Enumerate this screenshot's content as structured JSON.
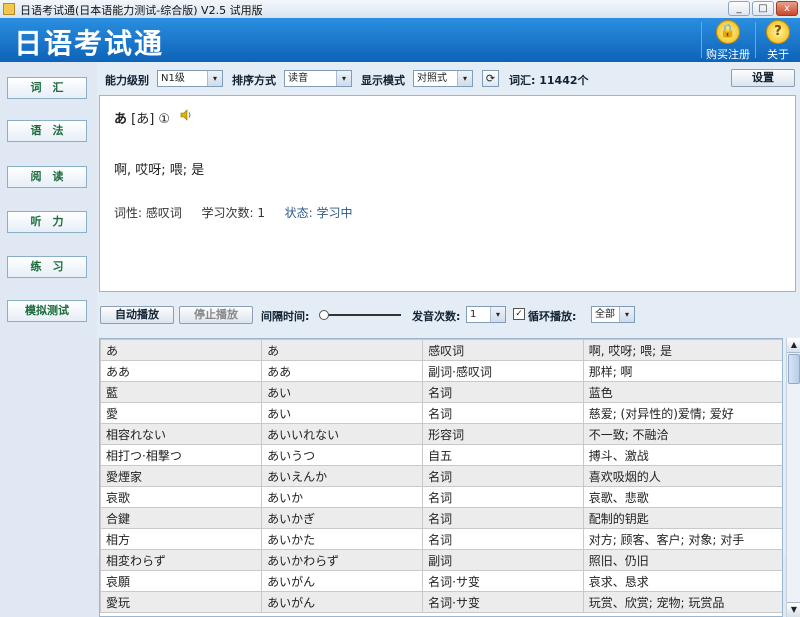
{
  "window": {
    "title": "日语考试通(日本语能力测试-综合版) V2.5 试用版",
    "min": "_",
    "max": "□",
    "close": "x"
  },
  "banner": {
    "app_title": "日语考试通",
    "buy_label": "购买注册",
    "about_label": "关于",
    "help_glyph": "?"
  },
  "nav": {
    "items": [
      "词　汇",
      "语　法",
      "阅　读",
      "听　力",
      "练　习",
      "模拟测试"
    ]
  },
  "toolbar": {
    "level_label": "能力级别",
    "level_value": "N1级",
    "sort_label": "排序方式",
    "sort_value": "读音",
    "mode_label": "显示模式",
    "mode_value": "对照式",
    "vocab_count": "词汇: 11442个",
    "settings_label": "设置",
    "refresh_glyph": "⟳"
  },
  "card": {
    "kana": "あ",
    "reading": "[あ] ①",
    "meaning": "啊, 哎呀; 喂; 是",
    "pos": "词性: 感叹词",
    "study_count": "学习次数: 1",
    "status": "状态: 学习中"
  },
  "controls": {
    "auto_play": "自动播放",
    "stop_play": "停止播放",
    "interval_label": "间隔时间:",
    "repeat_label": "发音次数:",
    "repeat_value": "1",
    "loop_label": "循环播放:",
    "loop_value": "全部",
    "loop_checked": "✓",
    "dropdown_glyph": "▾"
  },
  "table": {
    "rows": [
      [
        "あ",
        "あ",
        "感叹词",
        "啊, 哎呀; 喂; 是"
      ],
      [
        "ああ",
        "ああ",
        "副词·感叹词",
        "那样; 啊"
      ],
      [
        "藍",
        "あい",
        "名词",
        "蓝色"
      ],
      [
        "愛",
        "あい",
        "名词",
        "慈爱; (对异性的)爱情; 爱好"
      ],
      [
        "相容れない",
        "あいいれない",
        "形容词",
        "不一致; 不融洽"
      ],
      [
        "相打つ·相撃つ",
        "あいうつ",
        "自五",
        "搏斗、激战"
      ],
      [
        "愛煙家",
        "あいえんか",
        "名词",
        "喜欢吸烟的人"
      ],
      [
        "哀歌",
        "あいか",
        "名词",
        "哀歌、悲歌"
      ],
      [
        "合鍵",
        "あいかぎ",
        "名词",
        "配制的钥匙"
      ],
      [
        "相方",
        "あいかた",
        "名词",
        "对方; 顾客、客户; 对象; 对手"
      ],
      [
        "相変わらず",
        "あいかわらず",
        "副词",
        "照旧、仍旧"
      ],
      [
        "哀願",
        "あいがん",
        "名词·サ变",
        "哀求、恳求"
      ],
      [
        "愛玩",
        "あいがん",
        "名词·サ变",
        "玩赏、欣赏; 宠物; 玩赏品"
      ]
    ]
  },
  "scrollbar": {
    "up": "▲",
    "down": "▼"
  }
}
